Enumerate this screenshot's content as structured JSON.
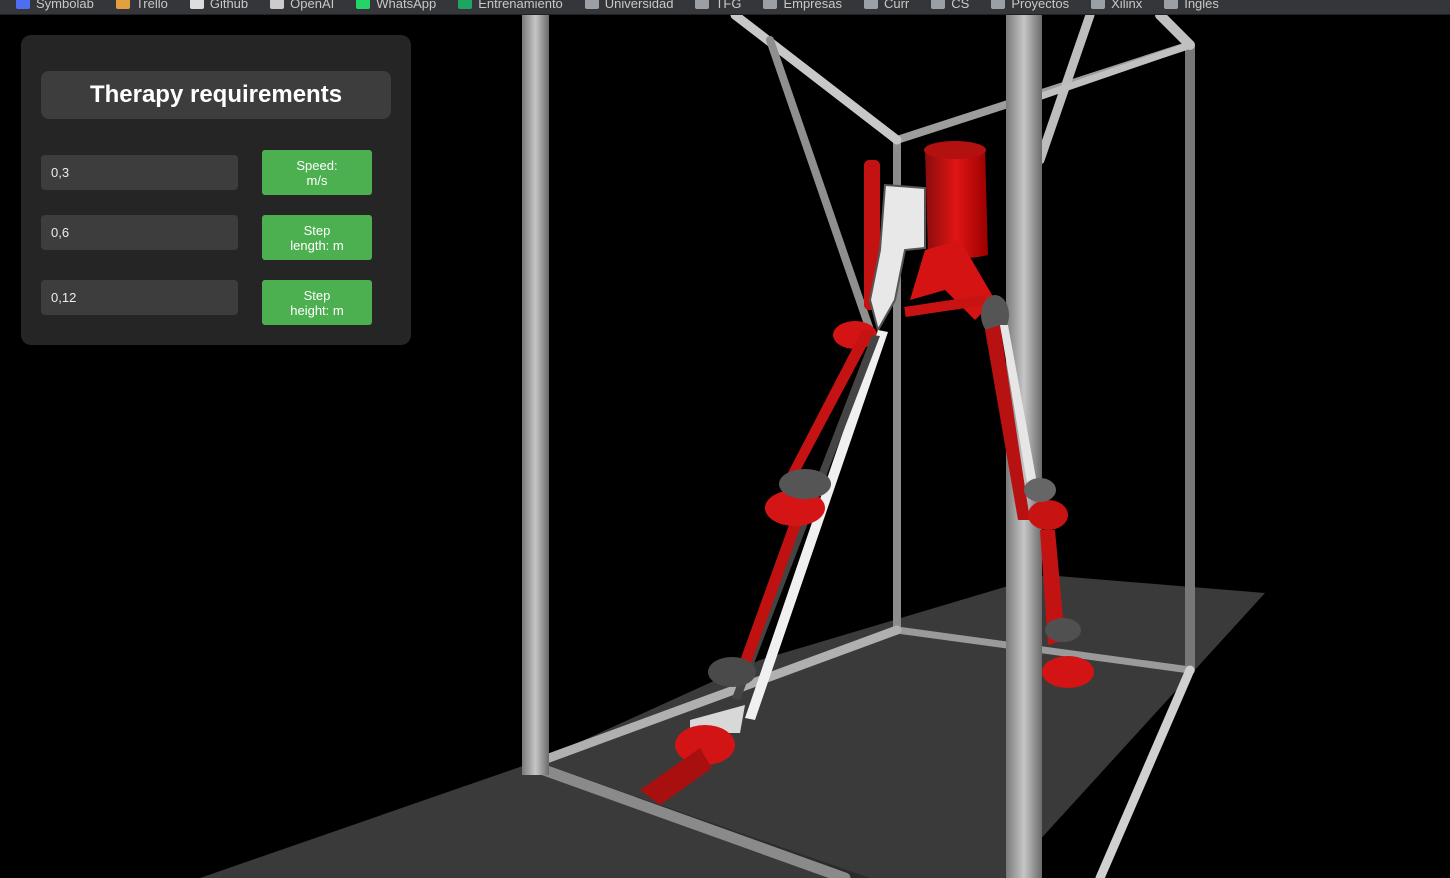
{
  "bookmarks": [
    {
      "label": "Symbolab",
      "icon": "symbolab-icon",
      "color": "#4e6ef2"
    },
    {
      "label": "Trello",
      "icon": "trello-icon",
      "color": "#e2a03f"
    },
    {
      "label": "Github",
      "icon": "github-icon",
      "color": "#dddddd"
    },
    {
      "label": "OpenAI",
      "icon": "openai-icon",
      "color": "#cccccc"
    },
    {
      "label": "WhatsApp",
      "icon": "whatsapp-icon",
      "color": "#25d366"
    },
    {
      "label": "Entrenamiento",
      "icon": "sheets-icon",
      "color": "#1fa463"
    },
    {
      "label": "Universidad",
      "icon": "folder-icon",
      "color": "#9aa0a6"
    },
    {
      "label": "TFG",
      "icon": "folder-icon",
      "color": "#9aa0a6"
    },
    {
      "label": "Empresas",
      "icon": "folder-icon",
      "color": "#9aa0a6"
    },
    {
      "label": "Curr",
      "icon": "folder-icon",
      "color": "#9aa0a6"
    },
    {
      "label": "CS",
      "icon": "folder-icon",
      "color": "#9aa0a6"
    },
    {
      "label": "Proyectos",
      "icon": "folder-icon",
      "color": "#9aa0a6"
    },
    {
      "label": "Xilinx",
      "icon": "folder-icon",
      "color": "#9aa0a6"
    },
    {
      "label": "Inglés",
      "icon": "folder-icon",
      "color": "#9aa0a6"
    }
  ],
  "panel": {
    "title": "Therapy requirements",
    "fields": [
      {
        "value": "0,3",
        "button": "Speed: m/s"
      },
      {
        "value": "0,6",
        "button": "Step length: m"
      },
      {
        "value": "0,12",
        "button": "Step height: m"
      }
    ]
  },
  "colors": {
    "accent": "#4caf50",
    "robot_red": "#e01515",
    "frame_grey": "#a8a8a8",
    "treadmill": "#3a3a3a",
    "background": "#000000"
  }
}
